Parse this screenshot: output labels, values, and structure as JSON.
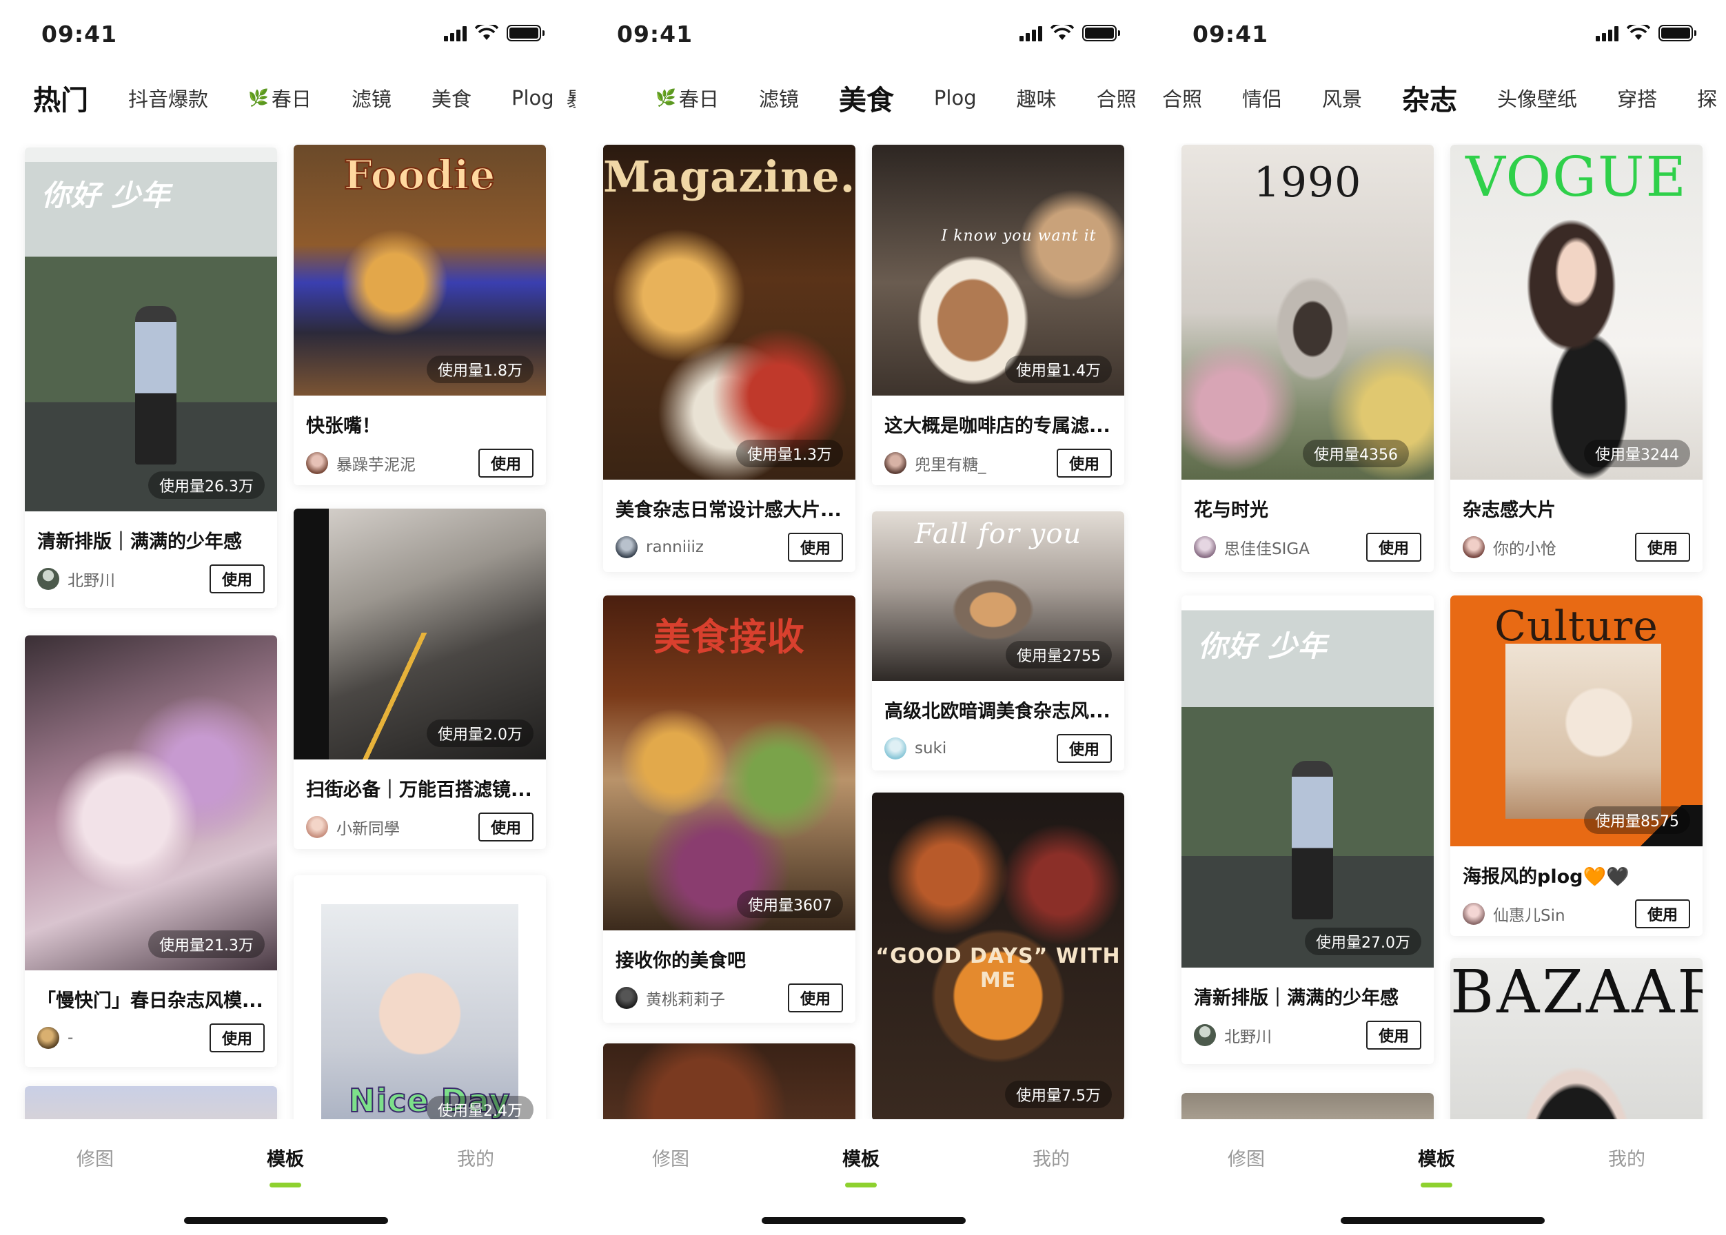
{
  "status_bar": {
    "time": "09:41"
  },
  "nav": {
    "edit": "修图",
    "templates": "模板",
    "mine": "我的"
  },
  "colors": {
    "accent": "#8ed12f",
    "leaf": "#3aa43a"
  },
  "screens": [
    {
      "tabs": [
        "热门",
        "抖音爆款",
        "春日",
        "滤镜",
        "美食",
        "Plog",
        "暴款"
      ],
      "active_tab": 0,
      "cards": [
        {
          "thumb_text": "你好 少年",
          "usage": "使用量26.3万",
          "title": "清新排版｜满满的少年感",
          "author": "北野川",
          "button": "使用"
        },
        {
          "thumb_text": "",
          "usage": "使用量21.3万",
          "title": "「慢快门」春日杂志风模...",
          "author": "-",
          "button": "使用"
        },
        {
          "thumb_text": "Foodie",
          "usage": "使用量1.8万",
          "title": "快张嘴！",
          "author": "暴躁芋泥泥",
          "button": "使用"
        },
        {
          "thumb_text": "",
          "usage": "使用量2.0万",
          "title": "扫街必备｜万能百搭滤镜...",
          "author": "小新同學",
          "button": "使用"
        },
        {
          "thumb_text": "Nice Day",
          "usage": "使用量2.4万",
          "title": "",
          "author": "",
          "button": ""
        }
      ]
    },
    {
      "tabs": [
        "春日",
        "滤镜",
        "美食",
        "Plog",
        "趣味",
        "合照"
      ],
      "active_tab": 2,
      "cards": [
        {
          "thumb_text": "Magazine.",
          "usage": "使用量1.3万",
          "title": "美食杂志日常设计感大片...",
          "author": "ranniiiz",
          "button": "使用"
        },
        {
          "thumb_text": "美食接收",
          "usage": "使用量3607",
          "title": "接收你的美食吧",
          "author": "黄桃莉莉子",
          "button": "使用"
        },
        {
          "thumb_text": "",
          "usage": "",
          "title": "",
          "author": "",
          "button": ""
        },
        {
          "thumb_text": "I know you want it",
          "usage": "使用量1.4万",
          "title": "这大概是咖啡店的专属滤...",
          "author": "兜里有糖_",
          "button": "使用"
        },
        {
          "thumb_text": "Fall for you",
          "usage": "使用量2755",
          "title": "高级北欧暗调美食杂志风...",
          "author": "suki",
          "button": "使用"
        },
        {
          "thumb_text": "“GOOD DAYS” WITH ME",
          "usage": "使用量7.5万",
          "title": "",
          "author": "",
          "button": ""
        }
      ]
    },
    {
      "tabs": [
        "合照",
        "情侣",
        "风景",
        "杂志",
        "头像壁纸",
        "穿搭",
        "探"
      ],
      "active_tab": 3,
      "cards": [
        {
          "thumb_text": "1990",
          "usage": "使用量4356",
          "title": "花与时光",
          "author": "思佳佳SIGA",
          "button": "使用"
        },
        {
          "thumb_text": "你好 少年",
          "usage": "使用量27.0万",
          "title": "清新排版｜满满的少年感",
          "author": "北野川",
          "button": "使用"
        },
        {
          "thumb_text": "",
          "usage": "",
          "title": "",
          "author": "",
          "button": ""
        },
        {
          "thumb_text": "VOGUE",
          "usage": "使用量3244",
          "title": "杂志感大片",
          "author": "你的小怆",
          "button": "使用"
        },
        {
          "thumb_text": "Culture",
          "usage": "使用量8575",
          "title": "海报风的plog🧡🖤",
          "author": "仙惠儿Sin",
          "button": "使用"
        },
        {
          "thumb_text": "BAZAAR",
          "usage": "",
          "title": "",
          "author": "",
          "button": ""
        }
      ]
    }
  ]
}
